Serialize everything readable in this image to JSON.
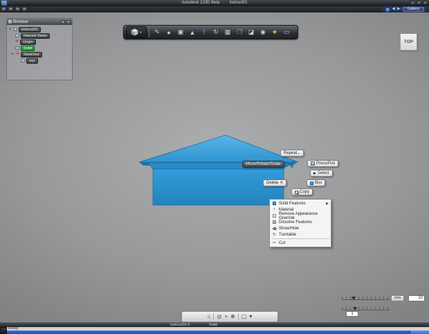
{
  "titlebar": {
    "app_name": "Autodesk 123D Beta",
    "doc_name": "instruct01"
  },
  "menubar": {
    "gallery_label": "Gallery"
  },
  "browser": {
    "title": "Browser",
    "items": [
      {
        "label": "instruct01"
      },
      {
        "label": "Named Views"
      },
      {
        "label": "Origin"
      },
      {
        "label": "Solid"
      },
      {
        "label": "Sketches"
      },
      {
        "label": "sq1"
      }
    ]
  },
  "viewcube": {
    "face_label": "TOP"
  },
  "marking_menu": {
    "repeat_label": "Repeat...",
    "move_label": "Move/Rotate/Scale",
    "press_pull_label": "Press/Pull",
    "select_label": "Select",
    "box_label": "Box",
    "delete_label": "Delete",
    "copy_label": "Copy"
  },
  "context_menu": {
    "items": [
      {
        "label": "Solid Features"
      },
      {
        "label": "Material"
      },
      {
        "label": "Remove Appearance Override"
      },
      {
        "label": "Dissolve Features"
      },
      {
        "label": "Show/Hide"
      },
      {
        "label": "Turntable"
      },
      {
        "label": "Cut"
      }
    ]
  },
  "grid_controls": {
    "units_label": "mm",
    "grid_size_value": "10",
    "snap_value": "1"
  },
  "statusbar": {
    "document_label": "instruct01:0",
    "mode_label": "Solid"
  },
  "taskbar": {
    "ready_label": "Ready"
  },
  "colors": {
    "model_blue": "#2e96d0",
    "selection_green": "#2f9e3f",
    "taskbar_blue": "#2563c9"
  }
}
